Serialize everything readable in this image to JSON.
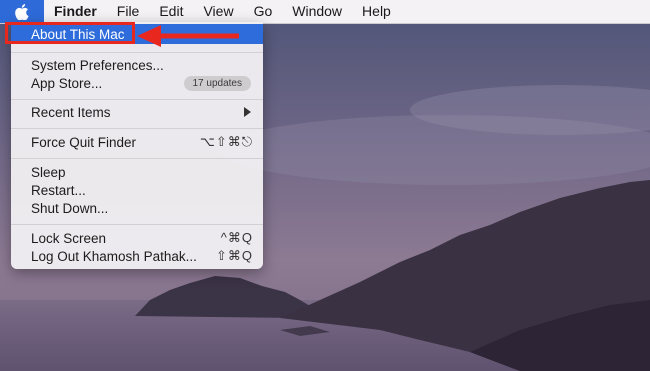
{
  "menubar": {
    "apple_icon": "apple-logo-icon",
    "items": [
      "Finder",
      "File",
      "Edit",
      "View",
      "Go",
      "Window",
      "Help"
    ]
  },
  "apple_menu": {
    "about": "About This Mac",
    "system_preferences": "System Preferences...",
    "app_store": "App Store...",
    "app_store_badge": "17 updates",
    "recent_items": "Recent Items",
    "force_quit": "Force Quit Finder",
    "force_quit_shortcut": "⌥⇧⌘⎋",
    "sleep": "Sleep",
    "restart": "Restart...",
    "shut_down": "Shut Down...",
    "lock_screen": "Lock Screen",
    "lock_screen_shortcut": "^⌘Q",
    "log_out": "Log Out Khamosh Pathak...",
    "log_out_shortcut": "⇧⌘Q"
  },
  "colors": {
    "selection": "#2f6cdb",
    "annotation": "#e8281f"
  }
}
